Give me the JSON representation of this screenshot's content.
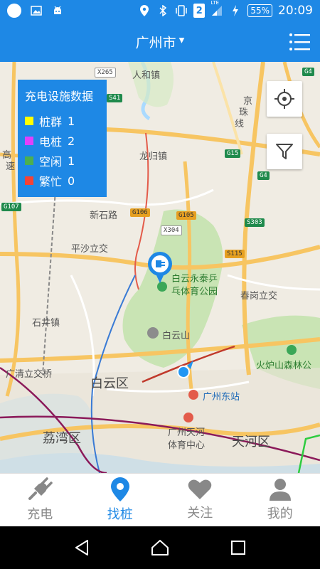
{
  "status_bar": {
    "sim_slot": "2",
    "network": "LTE",
    "battery": "55%",
    "time": "20:09"
  },
  "header": {
    "city": "广州市"
  },
  "stats_panel": {
    "title": "充电设施数据",
    "items": [
      {
        "label": "桩群",
        "count": "1",
        "color": "#ffff00"
      },
      {
        "label": "电桩",
        "count": "2",
        "color": "#e040fb"
      },
      {
        "label": "空闲",
        "count": "1",
        "color": "#4caf50"
      },
      {
        "label": "繁忙",
        "count": "0",
        "color": "#f44336"
      }
    ]
  },
  "map": {
    "labels": {
      "renhe": "人和镇",
      "longgui": "龙归镇",
      "xinshilu": "新石路",
      "pingsha": "平沙立交",
      "baiyun_park": "白云永泰乒",
      "baiyun_park2": "乓体育公园",
      "baiyunshan": "白云山",
      "chungang": "春岗立交",
      "shijing": "石井镇",
      "guangqing": "广清立交桥",
      "baiyun_district": "白云区",
      "guangzhou_east": "广州东站",
      "tianhe_sports": "广州天河",
      "tianhe_sports2": "体育中心",
      "tianhe_district": "天河区",
      "liwan": "荔湾区",
      "huolushan": "火炉山森林公",
      "jingzhu1": "京",
      "jingzhu2": "珠",
      "jingzhu3": "线",
      "gaosu1": "高",
      "gaosu2": "速"
    },
    "shields": {
      "g4_top": "G4",
      "x265": "X265",
      "s41": "S41",
      "g15": "G15",
      "g4_mid": "G4",
      "g107": "G107",
      "g106": "G106",
      "g105": "G105",
      "x304": "X304",
      "s303": "S303",
      "s115": "S115"
    }
  },
  "tabs": [
    {
      "label": "充电",
      "icon": "plug-icon"
    },
    {
      "label": "找桩",
      "icon": "location-pin-icon"
    },
    {
      "label": "关注",
      "icon": "heart-icon"
    },
    {
      "label": "我的",
      "icon": "person-icon"
    }
  ],
  "colors": {
    "primary": "#1e88e5",
    "inactive": "#888888"
  }
}
